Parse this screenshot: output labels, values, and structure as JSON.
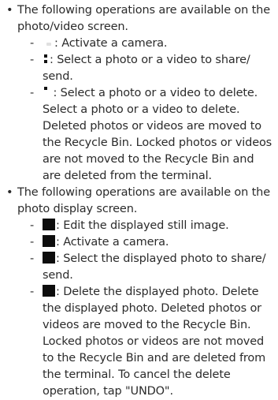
{
  "sections": [
    {
      "bullet": "•",
      "intro": "The following operations are available on the photo/video screen.",
      "items": [
        {
          "dash": "-",
          "icon": "camera-icon",
          "text": ": Activate a camera."
        },
        {
          "dash": "-",
          "icon": "share-icon",
          "text": ": Select a photo or a video to share/ send."
        },
        {
          "dash": "-",
          "icon": "delete-icon",
          "text": " : Select a photo or a video to delete. Select a photo or a video to delete. Deleted photos or videos are moved to the Recycle Bin. Locked photos or videos are not moved to the Recycle Bin and are deleted from the terminal."
        }
      ]
    },
    {
      "bullet": "•",
      "intro": "The following operations are available on the photo display screen.",
      "items": [
        {
          "dash": "-",
          "icon": "edit-icon",
          "text": ": Edit the displayed still image."
        },
        {
          "dash": "-",
          "icon": "camera-icon",
          "text": ": Activate a camera."
        },
        {
          "dash": "-",
          "icon": "share-icon",
          "text": ": Select the displayed photo to share/ send."
        },
        {
          "dash": "-",
          "icon": "delete-icon",
          "text": ": Delete the displayed photo. Delete the displayed photo. Deleted photos or videos are moved to the Recycle Bin. Locked photos or videos are not moved to the Recycle Bin and are deleted from the terminal. To cancel the delete operation, tap \"UNDO\"."
        }
      ]
    }
  ]
}
